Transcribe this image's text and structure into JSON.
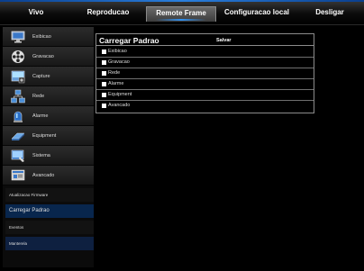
{
  "nav": {
    "tabs": [
      {
        "label": "Vivo"
      },
      {
        "label": "Reproducao"
      },
      {
        "label": "Remote Frame"
      },
      {
        "label": "Configuracao local"
      },
      {
        "label": "Desligar"
      }
    ],
    "active": "Remote Frame"
  },
  "sidebar": {
    "items": [
      {
        "label": "Exibicao",
        "icon": "monitor-icon"
      },
      {
        "label": "Gravacao",
        "icon": "film-reel-icon"
      },
      {
        "label": "Capture",
        "icon": "camera-capture-icon"
      },
      {
        "label": "Rede",
        "icon": "network-icon"
      },
      {
        "label": "Alarme",
        "icon": "alarm-light-icon"
      },
      {
        "label": "Equipment",
        "icon": "hard-drive-icon"
      },
      {
        "label": "Sistema",
        "icon": "system-icon"
      },
      {
        "label": "Avancado",
        "icon": "advanced-icon"
      }
    ],
    "subitems": [
      {
        "label": "Atualizacao Firmware"
      },
      {
        "label": "Carregar Padrao"
      },
      {
        "label": "Eventos"
      },
      {
        "label": "Manterela"
      }
    ],
    "selected": "Carregar Padrao"
  },
  "panel": {
    "title": "Carregar Padrao",
    "save_label": "Salvar",
    "options": [
      {
        "label": "Exibicao",
        "checked": true
      },
      {
        "label": "Gravacao",
        "checked": true
      },
      {
        "label": "Rede",
        "checked": true
      },
      {
        "label": "Alarme",
        "checked": true
      },
      {
        "label": "Equipment",
        "checked": true
      },
      {
        "label": "Avancado",
        "checked": true
      }
    ]
  },
  "colors": {
    "accent": "#2e8ff0",
    "selected_bg": "#08264d"
  }
}
